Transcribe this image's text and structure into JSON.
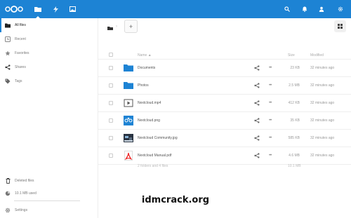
{
  "apps": {
    "files_icon": "folder-icon",
    "activity_icon": "lightning-icon",
    "gallery_icon": "image-icon"
  },
  "header": {
    "search_icon": "search-icon",
    "notifications_icon": "bell-icon",
    "contacts_icon": "contacts-icon",
    "settings_icon": "gear-icon",
    "accent": "#1d83d4"
  },
  "sidebar": {
    "items": [
      {
        "label": "All files",
        "icon": "folder-icon"
      },
      {
        "label": "Recent",
        "icon": "clock-icon"
      },
      {
        "label": "Favorites",
        "icon": "star-icon"
      },
      {
        "label": "Shares",
        "icon": "share-icon"
      },
      {
        "label": "Tags",
        "icon": "tag-icon"
      }
    ],
    "deleted_label": "Deleted files",
    "quota_label": "10.1 MB used",
    "settings_label": "Settings"
  },
  "toolbar": {
    "add_label": "+"
  },
  "table": {
    "headers": {
      "name": "Name ▲",
      "size": "Size",
      "modified": "Modified"
    },
    "rows": [
      {
        "name": "Documents",
        "type": "folder",
        "size": "23 KB",
        "modified": "32 minutes ago"
      },
      {
        "name": "Photos",
        "type": "folder",
        "size": "2.5 MB",
        "modified": "32 minutes ago"
      },
      {
        "name": "Nextcloud.mp4",
        "type": "video",
        "size": "412 KB",
        "modified": "32 minutes ago"
      },
      {
        "name": "Nextcloud.png",
        "type": "image",
        "size": "35 KB",
        "modified": "32 minutes ago"
      },
      {
        "name": "Nextcloud Community.jpg",
        "type": "photo",
        "size": "585 KB",
        "modified": "32 minutes ago"
      },
      {
        "name": "Nextcloud Manual.pdf",
        "type": "pdf",
        "size": "4.6 MB",
        "modified": "32 minutes ago"
      }
    ],
    "summary": {
      "text": "2 folders and 4 files",
      "size": "10.1 MB"
    }
  },
  "watermark": "idmcrack.org"
}
